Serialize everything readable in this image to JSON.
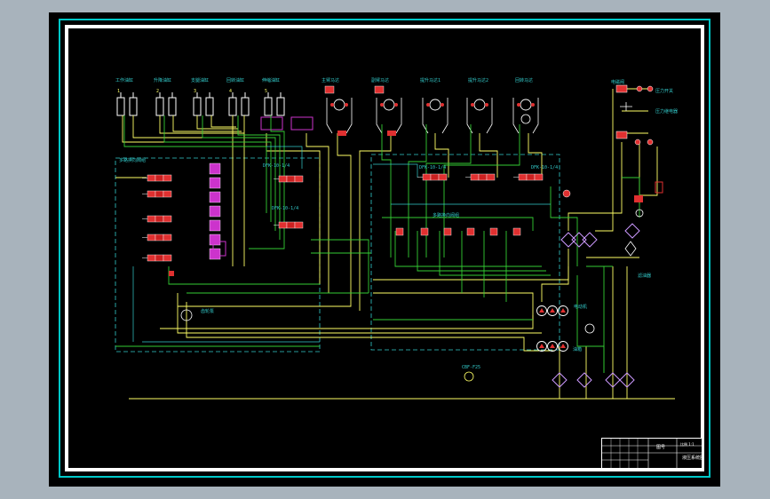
{
  "drawing": {
    "background": "#a8b3bc",
    "canvas_color": "#000000",
    "border_color_outer": "#00c8c8",
    "border_color_inner": "#ffffff",
    "line_colors": {
      "yellow": "#ffff66",
      "green": "#33cc33",
      "cyan": "#33cccc",
      "white": "#ffffff",
      "red": "#e03030",
      "magenta": "#cc33cc"
    }
  },
  "top_labels": [
    "工作油缸",
    "升降油缸",
    "支腿油缸",
    "回转油缸",
    "伸缩油缸",
    "主臂马达",
    "副臂马达",
    "提升马达1",
    "提升马达2",
    "回转马达"
  ],
  "top_numbers": [
    "1",
    "2",
    "3",
    "4",
    "5",
    "6",
    "7",
    "8",
    "9",
    "10"
  ],
  "valve_block_left_label": "多路换向阀组",
  "valve_block_right_label": "多路换向阀组",
  "valve_labels": [
    "DFK-10-1/4",
    "DFK-10-1/4",
    "DFK-10-1/4",
    "DFK-10-1/4"
  ],
  "right_top_labels": [
    "电磁阀",
    "压力开关",
    "压力继电器"
  ],
  "pump_labels": [
    "齿轮泵",
    "电动机",
    "CBF-F25"
  ],
  "filter_label": "滤油器",
  "tank_label": "油箱",
  "title_block": {
    "company": "图号",
    "drawing_no": "比例 1:1",
    "name": "液压系统图"
  }
}
